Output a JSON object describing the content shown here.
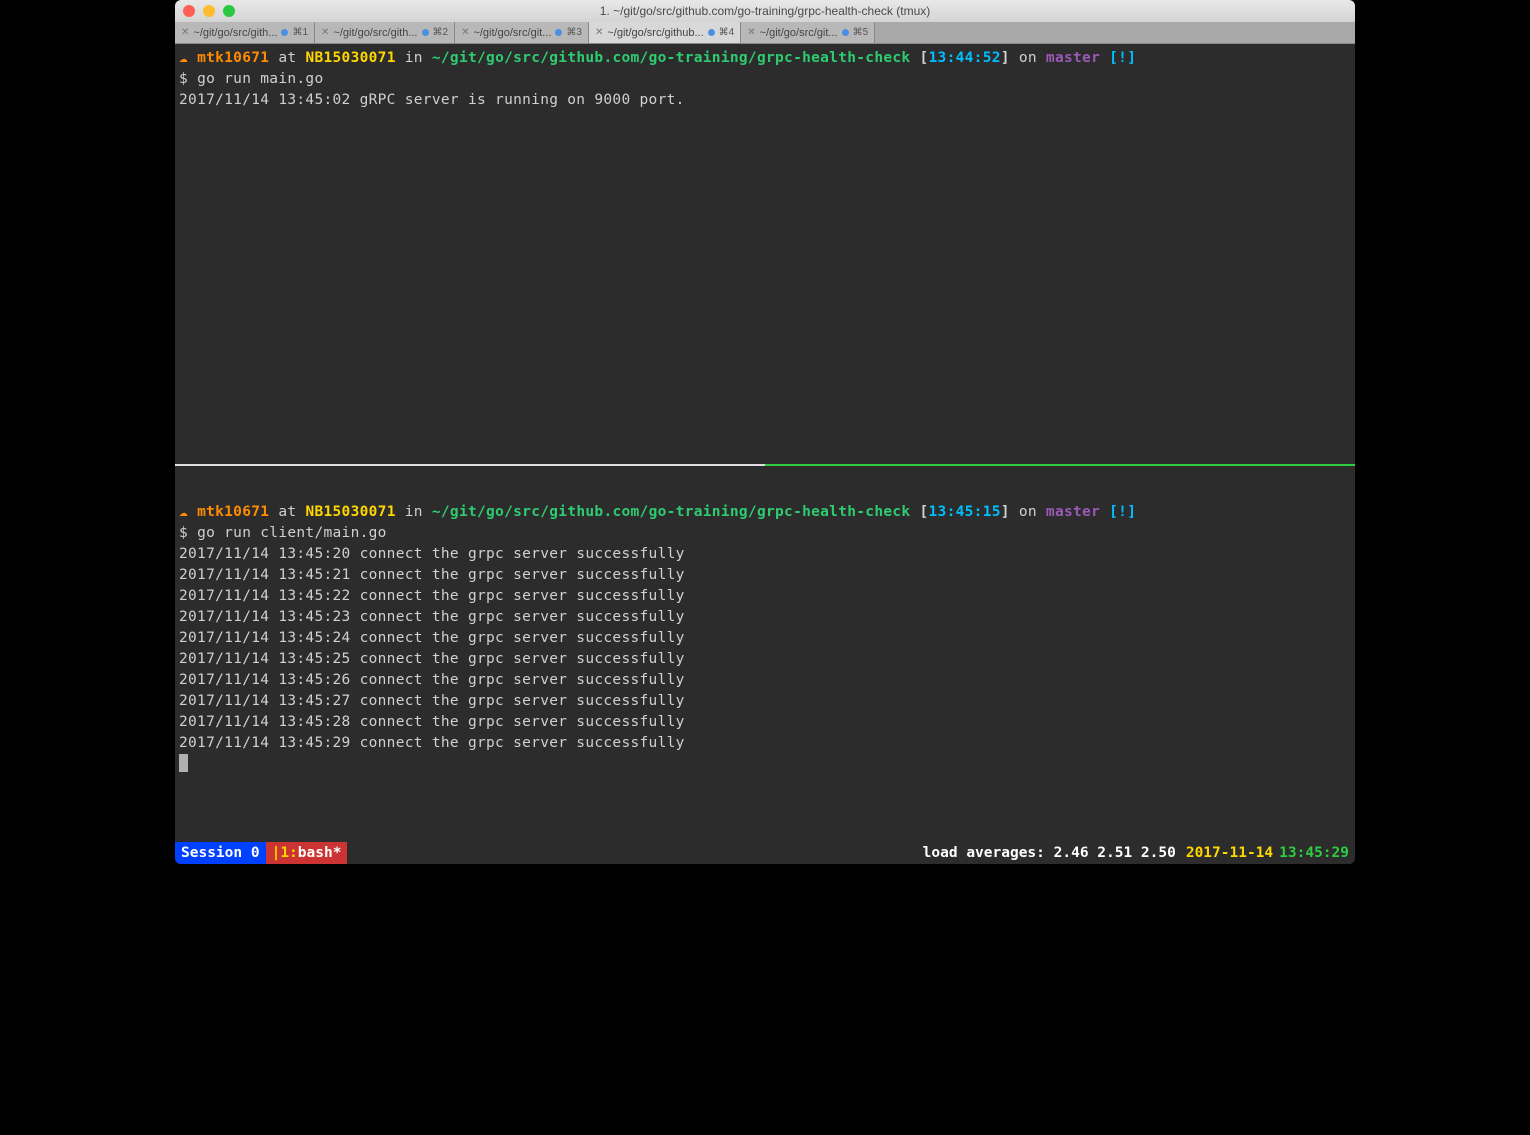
{
  "window": {
    "title": "1. ~/git/go/src/github.com/go-training/grpc-health-check (tmux)"
  },
  "tabs": [
    {
      "label": "~/git/go/src/gith...",
      "shortcut": "⌘1",
      "active": false
    },
    {
      "label": "~/git/go/src/gith...",
      "shortcut": "⌘2",
      "active": false
    },
    {
      "label": "~/git/go/src/git...",
      "shortcut": "⌘3",
      "active": false
    },
    {
      "label": "~/git/go/src/github...",
      "shortcut": "⌘4",
      "active": true
    },
    {
      "label": "~/git/go/src/git...",
      "shortcut": "⌘5",
      "active": false
    }
  ],
  "pane_top": {
    "prompt": {
      "user": "mtk10671",
      "at": "at",
      "host": "NB15030071",
      "in": "in",
      "path": "~/git/go/src/github.com/go-training/grpc-health-check",
      "time": "13:44:52",
      "on": "on",
      "branch": "master",
      "flag": "[!]"
    },
    "command": "go run main.go",
    "output": [
      "2017/11/14 13:45:02 gRPC server is running on 9000 port."
    ]
  },
  "pane_bottom": {
    "prompt": {
      "user": "mtk10671",
      "at": "at",
      "host": "NB15030071",
      "in": "in",
      "path": "~/git/go/src/github.com/go-training/grpc-health-check",
      "time": "13:45:15",
      "on": "on",
      "branch": "master",
      "flag": "[!]"
    },
    "command": "go run client/main.go",
    "output": [
      "2017/11/14 13:45:20 connect the grpc server successfully",
      "2017/11/14 13:45:21 connect the grpc server successfully",
      "2017/11/14 13:45:22 connect the grpc server successfully",
      "2017/11/14 13:45:23 connect the grpc server successfully",
      "2017/11/14 13:45:24 connect the grpc server successfully",
      "2017/11/14 13:45:25 connect the grpc server successfully",
      "2017/11/14 13:45:26 connect the grpc server successfully",
      "2017/11/14 13:45:27 connect the grpc server successfully",
      "2017/11/14 13:45:28 connect the grpc server successfully",
      "2017/11/14 13:45:29 connect the grpc server successfully"
    ]
  },
  "statusbar": {
    "session": "Session 0",
    "window": {
      "pipe": "|",
      "index": "1:",
      "name": "bash*"
    },
    "load_label": "load averages:",
    "load_values": "2.46 2.51 2.50",
    "date": "2017-11-14",
    "time": "13:45:29"
  },
  "icons": {
    "cloud": "☁"
  }
}
